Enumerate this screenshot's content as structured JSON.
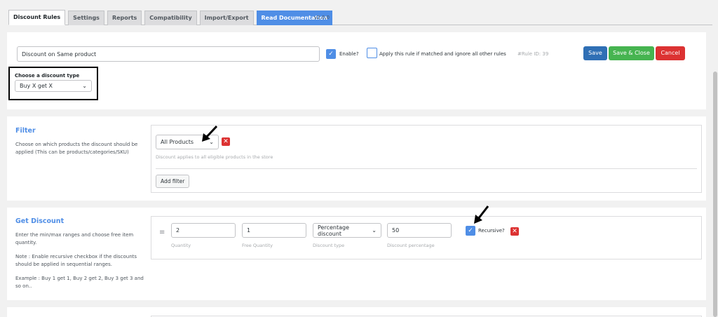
{
  "tabs": [
    {
      "label": "Discount Rules",
      "active": true
    },
    {
      "label": "Settings"
    },
    {
      "label": "Reports"
    },
    {
      "label": "Compatibility"
    },
    {
      "label": "Import/Export"
    },
    {
      "label": "Read Documentation"
    }
  ],
  "version": "v2.0.0",
  "rule": {
    "name_value": "Discount on Same product",
    "enable_label": "Enable?",
    "enable_checked": true,
    "apply_only_label": "Apply this rule if matched and ignore all other rules",
    "apply_only_checked": false,
    "rule_id": "#Rule ID: 39",
    "save_label": "Save",
    "save_close_label": "Save & Close",
    "cancel_label": "Cancel",
    "discount_type_label": "Choose a discount type",
    "discount_type_value": "Buy X get X"
  },
  "filter": {
    "title": "Filter",
    "description": "Choose on which products the discount should be applied (This can be products/categories/SKU)",
    "select_value": "All Products",
    "hint": "Discount applies to all eligible products in the store",
    "add_filter_label": "Add filter"
  },
  "get_discount": {
    "title": "Get Discount",
    "description": "Enter the min/max ranges and choose free item quantity.",
    "note": "Note : Enable recursive checkbox if the discounts should be applied in sequential ranges.",
    "example": "Example : Buy 1 get 1, Buy 2 get 2, Buy 3 get 3 and so on..",
    "quantity_value": "2",
    "quantity_label": "Quantity",
    "free_quantity_value": "1",
    "free_quantity_label": "Free Quantity",
    "discount_type_value": "Percentage discount",
    "discount_type_label": "Discount type",
    "discount_percentage_value": "50",
    "discount_percentage_label": "Discount percentage",
    "recursive_label": "Recursive?",
    "recursive_checked": true
  },
  "colors": {
    "accent": "#4f8ee6",
    "save": "#2f6fb5",
    "save_close": "#46b450",
    "cancel": "#dc3232"
  }
}
